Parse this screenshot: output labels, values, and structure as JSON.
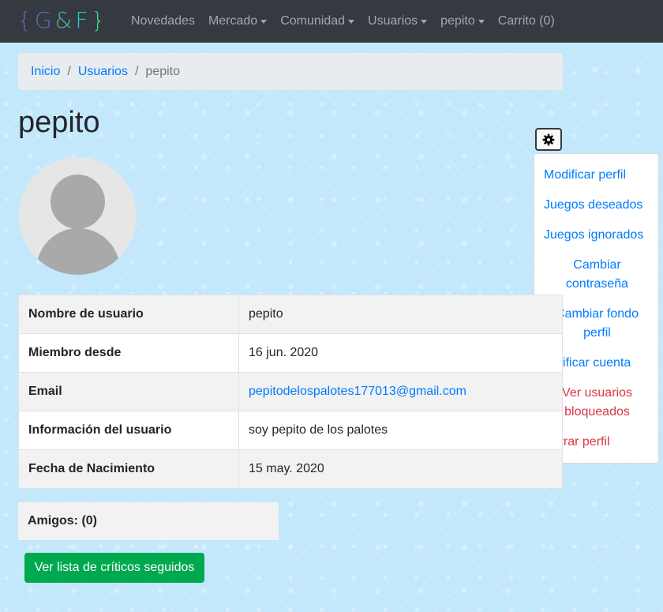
{
  "navbar": {
    "brand": {
      "open": "{",
      "g": "G",
      "amp": "&",
      "f": "F",
      "close": "}"
    },
    "items": [
      {
        "label": "Novedades",
        "dropdown": false
      },
      {
        "label": "Mercado",
        "dropdown": true
      },
      {
        "label": "Comunidad",
        "dropdown": true
      },
      {
        "label": "Usuarios",
        "dropdown": true
      },
      {
        "label": "pepito",
        "dropdown": true
      },
      {
        "label": "Carrito (0)",
        "dropdown": false
      }
    ]
  },
  "breadcrumb": {
    "home": "Inicio",
    "section": "Usuarios",
    "current": "pepito",
    "separator": "/"
  },
  "profile": {
    "title": "pepito"
  },
  "menu": {
    "items": [
      {
        "label": "Modificar perfil"
      },
      {
        "label": "Juegos deseados"
      },
      {
        "label": "Juegos ignorados"
      },
      {
        "label": "Cambiar contraseña"
      },
      {
        "label": "Cambiar fondo perfil"
      },
      {
        "label": "Verificar cuenta"
      },
      {
        "label": "Ver usuarios bloqueados"
      },
      {
        "label": "Borrar perfil"
      }
    ]
  },
  "details": [
    {
      "key": "Nombre de usuario",
      "value": "pepito"
    },
    {
      "key": "Miembro desde",
      "value": "16 jun. 2020"
    },
    {
      "key": "Email",
      "value": "pepitodelospalotes177013@gmail.com"
    },
    {
      "key": "Información del usuario",
      "value": "soy pepito de los palotes"
    },
    {
      "key": "Fecha de Nacimiento",
      "value": "15 may. 2020"
    }
  ],
  "friends": {
    "label": "Amigos: (0)"
  },
  "critics_button": {
    "label": "Ver lista de críticos seguidos"
  },
  "bottom_heading": "",
  "colors": {
    "navbar": "#343a40",
    "link": "#007bff",
    "danger": "#dc3545",
    "success": "#00a84f",
    "background": "#c3e8fb"
  }
}
